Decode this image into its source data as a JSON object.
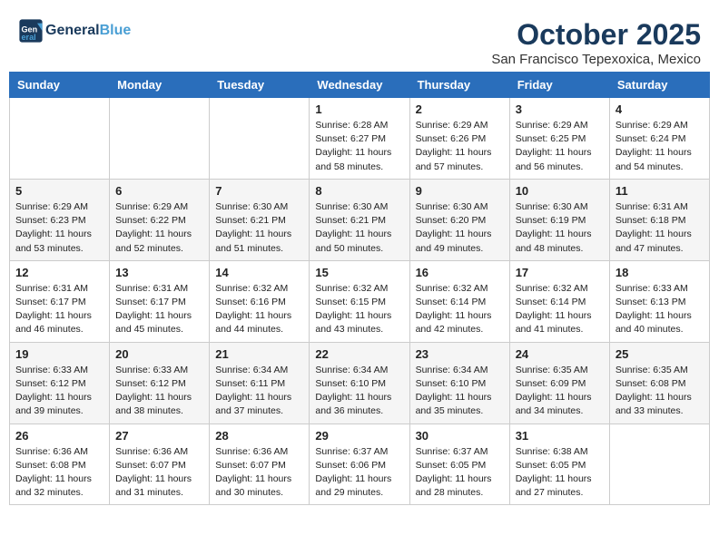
{
  "header": {
    "logo_line1": "General",
    "logo_line2": "Blue",
    "month": "October 2025",
    "location": "San Francisco Tepexoxica, Mexico"
  },
  "days_of_week": [
    "Sunday",
    "Monday",
    "Tuesday",
    "Wednesday",
    "Thursday",
    "Friday",
    "Saturday"
  ],
  "weeks": [
    [
      {
        "day": "",
        "info": ""
      },
      {
        "day": "",
        "info": ""
      },
      {
        "day": "",
        "info": ""
      },
      {
        "day": "1",
        "info": "Sunrise: 6:28 AM\nSunset: 6:27 PM\nDaylight: 11 hours\nand 58 minutes."
      },
      {
        "day": "2",
        "info": "Sunrise: 6:29 AM\nSunset: 6:26 PM\nDaylight: 11 hours\nand 57 minutes."
      },
      {
        "day": "3",
        "info": "Sunrise: 6:29 AM\nSunset: 6:25 PM\nDaylight: 11 hours\nand 56 minutes."
      },
      {
        "day": "4",
        "info": "Sunrise: 6:29 AM\nSunset: 6:24 PM\nDaylight: 11 hours\nand 54 minutes."
      }
    ],
    [
      {
        "day": "5",
        "info": "Sunrise: 6:29 AM\nSunset: 6:23 PM\nDaylight: 11 hours\nand 53 minutes."
      },
      {
        "day": "6",
        "info": "Sunrise: 6:29 AM\nSunset: 6:22 PM\nDaylight: 11 hours\nand 52 minutes."
      },
      {
        "day": "7",
        "info": "Sunrise: 6:30 AM\nSunset: 6:21 PM\nDaylight: 11 hours\nand 51 minutes."
      },
      {
        "day": "8",
        "info": "Sunrise: 6:30 AM\nSunset: 6:21 PM\nDaylight: 11 hours\nand 50 minutes."
      },
      {
        "day": "9",
        "info": "Sunrise: 6:30 AM\nSunset: 6:20 PM\nDaylight: 11 hours\nand 49 minutes."
      },
      {
        "day": "10",
        "info": "Sunrise: 6:30 AM\nSunset: 6:19 PM\nDaylight: 11 hours\nand 48 minutes."
      },
      {
        "day": "11",
        "info": "Sunrise: 6:31 AM\nSunset: 6:18 PM\nDaylight: 11 hours\nand 47 minutes."
      }
    ],
    [
      {
        "day": "12",
        "info": "Sunrise: 6:31 AM\nSunset: 6:17 PM\nDaylight: 11 hours\nand 46 minutes."
      },
      {
        "day": "13",
        "info": "Sunrise: 6:31 AM\nSunset: 6:17 PM\nDaylight: 11 hours\nand 45 minutes."
      },
      {
        "day": "14",
        "info": "Sunrise: 6:32 AM\nSunset: 6:16 PM\nDaylight: 11 hours\nand 44 minutes."
      },
      {
        "day": "15",
        "info": "Sunrise: 6:32 AM\nSunset: 6:15 PM\nDaylight: 11 hours\nand 43 minutes."
      },
      {
        "day": "16",
        "info": "Sunrise: 6:32 AM\nSunset: 6:14 PM\nDaylight: 11 hours\nand 42 minutes."
      },
      {
        "day": "17",
        "info": "Sunrise: 6:32 AM\nSunset: 6:14 PM\nDaylight: 11 hours\nand 41 minutes."
      },
      {
        "day": "18",
        "info": "Sunrise: 6:33 AM\nSunset: 6:13 PM\nDaylight: 11 hours\nand 40 minutes."
      }
    ],
    [
      {
        "day": "19",
        "info": "Sunrise: 6:33 AM\nSunset: 6:12 PM\nDaylight: 11 hours\nand 39 minutes."
      },
      {
        "day": "20",
        "info": "Sunrise: 6:33 AM\nSunset: 6:12 PM\nDaylight: 11 hours\nand 38 minutes."
      },
      {
        "day": "21",
        "info": "Sunrise: 6:34 AM\nSunset: 6:11 PM\nDaylight: 11 hours\nand 37 minutes."
      },
      {
        "day": "22",
        "info": "Sunrise: 6:34 AM\nSunset: 6:10 PM\nDaylight: 11 hours\nand 36 minutes."
      },
      {
        "day": "23",
        "info": "Sunrise: 6:34 AM\nSunset: 6:10 PM\nDaylight: 11 hours\nand 35 minutes."
      },
      {
        "day": "24",
        "info": "Sunrise: 6:35 AM\nSunset: 6:09 PM\nDaylight: 11 hours\nand 34 minutes."
      },
      {
        "day": "25",
        "info": "Sunrise: 6:35 AM\nSunset: 6:08 PM\nDaylight: 11 hours\nand 33 minutes."
      }
    ],
    [
      {
        "day": "26",
        "info": "Sunrise: 6:36 AM\nSunset: 6:08 PM\nDaylight: 11 hours\nand 32 minutes."
      },
      {
        "day": "27",
        "info": "Sunrise: 6:36 AM\nSunset: 6:07 PM\nDaylight: 11 hours\nand 31 minutes."
      },
      {
        "day": "28",
        "info": "Sunrise: 6:36 AM\nSunset: 6:07 PM\nDaylight: 11 hours\nand 30 minutes."
      },
      {
        "day": "29",
        "info": "Sunrise: 6:37 AM\nSunset: 6:06 PM\nDaylight: 11 hours\nand 29 minutes."
      },
      {
        "day": "30",
        "info": "Sunrise: 6:37 AM\nSunset: 6:05 PM\nDaylight: 11 hours\nand 28 minutes."
      },
      {
        "day": "31",
        "info": "Sunrise: 6:38 AM\nSunset: 6:05 PM\nDaylight: 11 hours\nand 27 minutes."
      },
      {
        "day": "",
        "info": ""
      }
    ]
  ]
}
